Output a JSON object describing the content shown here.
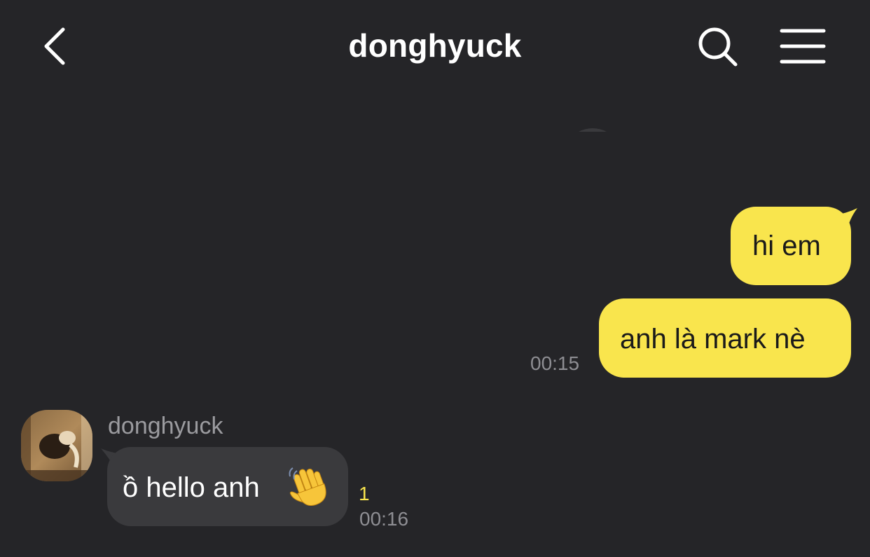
{
  "header": {
    "title": "donghyuck",
    "back_icon": "chevron-left-icon",
    "search_icon": "search-icon",
    "menu_icon": "hamburger-menu-icon"
  },
  "messages": {
    "outgoing": [
      {
        "text": "hi em"
      },
      {
        "text": "anh là mark nè",
        "time": "00:15"
      }
    ],
    "incoming": {
      "sender": "donghyuck",
      "text": "ồ hello anh",
      "emoji": "waving-hand-icon",
      "unread_count": "1",
      "time": "00:16"
    }
  },
  "colors": {
    "background": "#252528",
    "outgoing_bubble": "#f9e54d",
    "incoming_bubble": "#3a3a3d",
    "timestamp": "#8e8e93",
    "unread": "#f9e54d"
  }
}
